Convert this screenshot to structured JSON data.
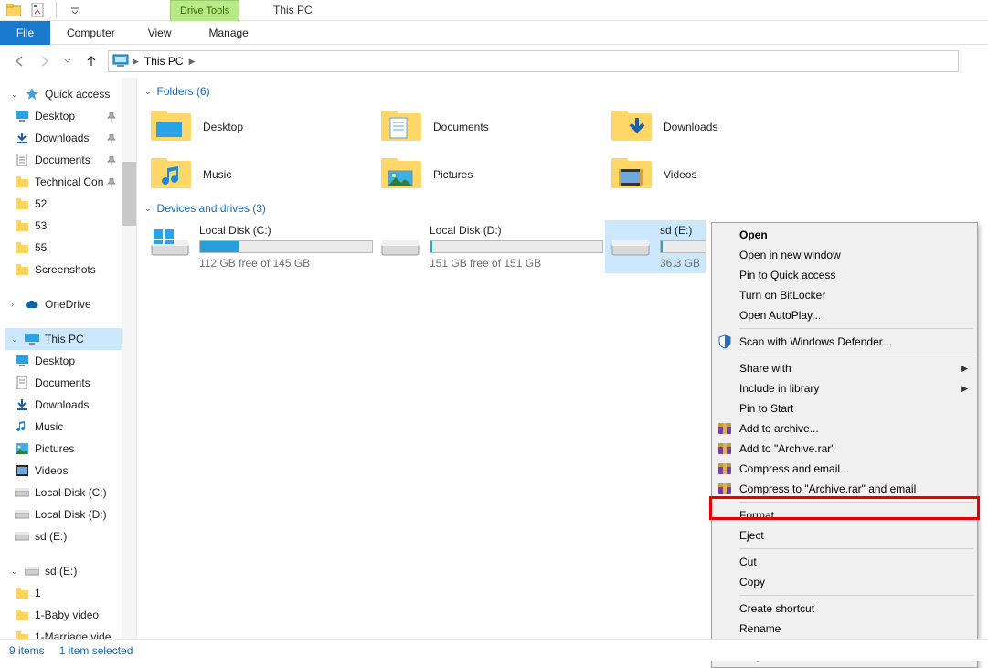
{
  "window": {
    "title": "This PC",
    "drive_tools": "Drive Tools"
  },
  "ribbon": {
    "file": "File",
    "computer": "Computer",
    "view": "View",
    "manage": "Manage"
  },
  "addr": {
    "location": "This PC"
  },
  "tree": {
    "quick": {
      "label": "Quick access",
      "items": [
        {
          "label": "Desktop",
          "pinned": true
        },
        {
          "label": "Downloads",
          "pinned": true
        },
        {
          "label": "Documents",
          "pinned": true
        },
        {
          "label": "Technical Con",
          "pinned": true
        },
        {
          "label": "52",
          "pinned": false
        },
        {
          "label": "53",
          "pinned": false
        },
        {
          "label": "55",
          "pinned": false
        },
        {
          "label": "Screenshots",
          "pinned": false
        }
      ]
    },
    "onedrive": {
      "label": "OneDrive"
    },
    "thispc": {
      "label": "This PC",
      "items": [
        {
          "label": "Desktop"
        },
        {
          "label": "Documents"
        },
        {
          "label": "Downloads"
        },
        {
          "label": "Music"
        },
        {
          "label": "Pictures"
        },
        {
          "label": "Videos"
        },
        {
          "label": "Local Disk (C:)"
        },
        {
          "label": "Local Disk (D:)"
        },
        {
          "label": "sd (E:)"
        }
      ]
    },
    "sd": {
      "label": "sd (E:)",
      "items": [
        {
          "label": "1"
        },
        {
          "label": "1-Baby video"
        },
        {
          "label": "1-Marriage vide"
        }
      ]
    }
  },
  "content": {
    "folders": {
      "header": "Folders (6)",
      "items": [
        {
          "label": "Desktop"
        },
        {
          "label": "Documents"
        },
        {
          "label": "Downloads"
        },
        {
          "label": "Music"
        },
        {
          "label": "Pictures"
        },
        {
          "label": "Videos"
        }
      ]
    },
    "drives": {
      "header": "Devices and drives (3)",
      "items": [
        {
          "title": "Local Disk (C:)",
          "free": "112 GB free of 145 GB",
          "fill_pct": 23
        },
        {
          "title": "Local Disk (D:)",
          "free": "151 GB free of 151 GB",
          "fill_pct": 1
        },
        {
          "title": "sd (E:)",
          "free": "36.3 GB",
          "fill_pct": 3,
          "selected": true
        }
      ]
    }
  },
  "ctx": {
    "open": "Open",
    "open_new": "Open in new window",
    "pin_qa": "Pin to Quick access",
    "bitlocker": "Turn on BitLocker",
    "autoplay": "Open AutoPlay...",
    "defender": "Scan with Windows Defender...",
    "share": "Share with",
    "include": "Include in library",
    "pin_start": "Pin to Start",
    "add_archive": "Add to archive...",
    "add_archive_rar": "Add to \"Archive.rar\"",
    "compress_email": "Compress and email...",
    "compress_rar_email": "Compress to \"Archive.rar\" and email",
    "format": "Format...",
    "eject": "Eject",
    "cut": "Cut",
    "copy": "Copy",
    "shortcut": "Create shortcut",
    "rename": "Rename",
    "properties": "Properties"
  },
  "status": {
    "count": "9 items",
    "selected": "1 item selected"
  }
}
